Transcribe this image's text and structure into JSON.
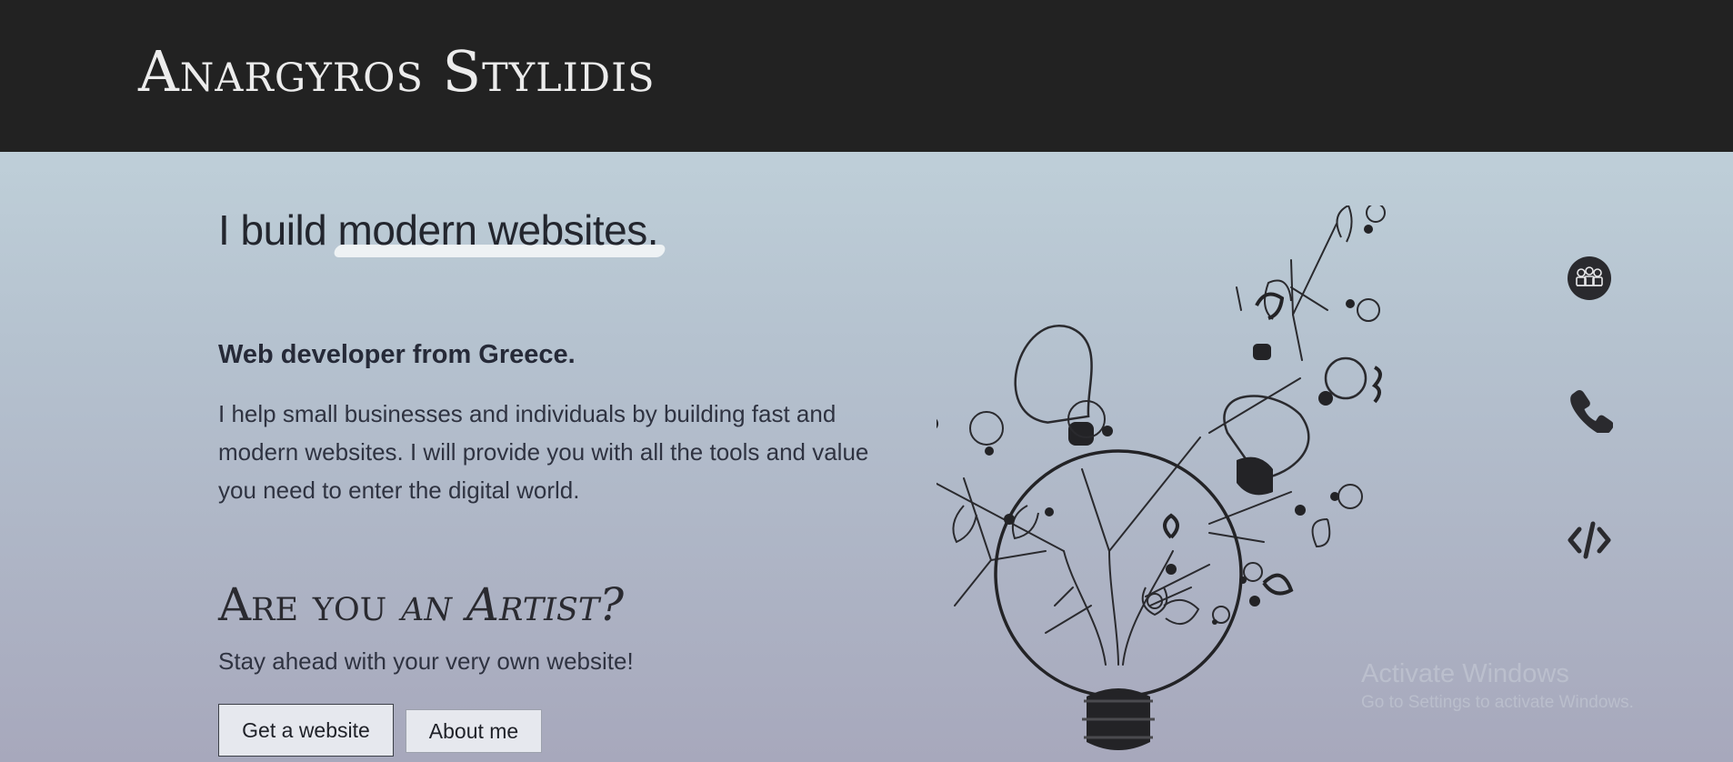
{
  "header": {
    "brand": "Anargyros Stylidis"
  },
  "hero": {
    "title_prefix": "I build ",
    "title_highlight": "modern websites.",
    "subtitle": "Web developer from Greece.",
    "intro": "I help small businesses and individuals by building fast and modern websites. I will provide you with all the tools and value you need to enter the digital world."
  },
  "artist": {
    "heading_prefix": "Are you ",
    "heading_emph": "an Artist?",
    "subtext": "Stay ahead with your very own website!"
  },
  "buttons": {
    "primary_label": "Get a website",
    "secondary_label": "About me"
  },
  "side_icons": [
    "team-icon",
    "phone-icon",
    "code-icon"
  ],
  "watermark": {
    "line1": "Activate Windows",
    "line2": "Go to Settings to activate Windows."
  },
  "colors": {
    "header_bg": "#222222",
    "brand_text": "#ececec",
    "gradient_top": "#c6d9e0",
    "gradient_bottom": "#a7a8bc",
    "text": "#23262e"
  }
}
